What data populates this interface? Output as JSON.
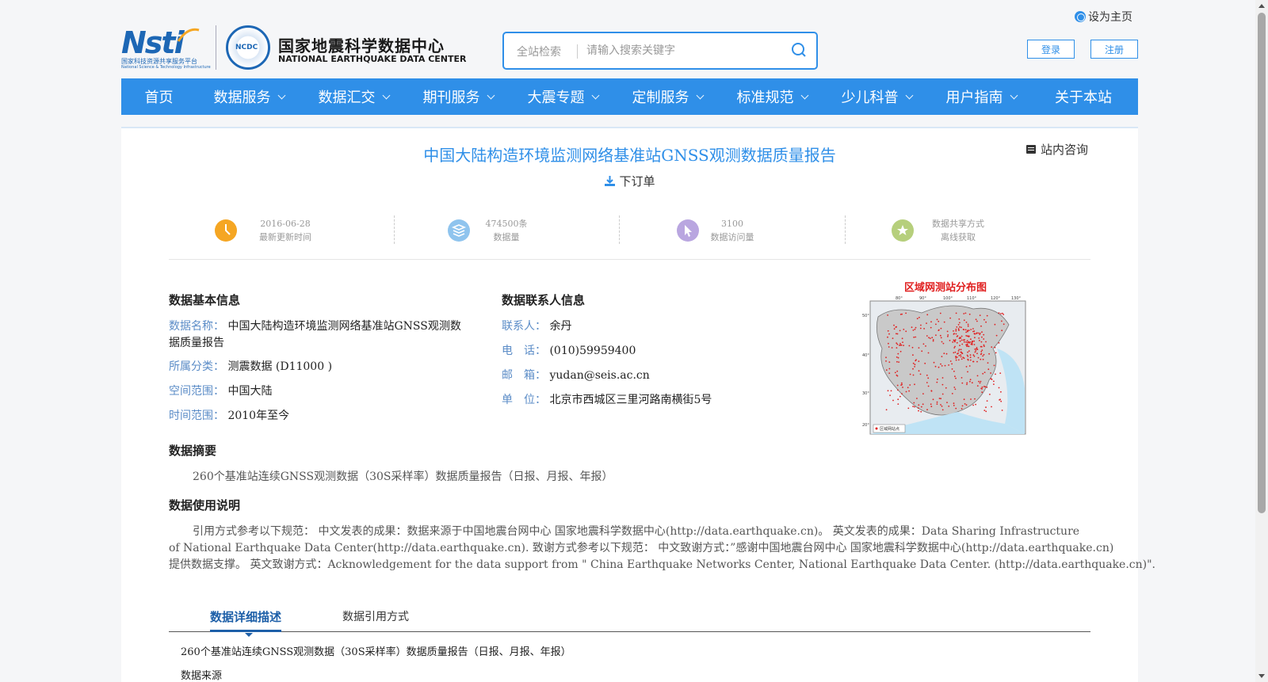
{
  "header": {
    "set_home": "设为主页",
    "logo": {
      "nsti": "Nsti",
      "nsti_sub": "国家科技资源共享服务平台",
      "nsti_sub_en": "National Science & Technology Infrastructure",
      "seal": "NCDC",
      "cn": "国家地震科学数据中心",
      "en": "NATIONAL EARTHQUAKE DATA CENTER"
    },
    "search": {
      "scope": "全站检索",
      "placeholder": "请输入搜索关键字"
    },
    "login": "登录",
    "register": "注册"
  },
  "nav": {
    "items": [
      {
        "label": "首页",
        "dropdown": false
      },
      {
        "label": "数据服务",
        "dropdown": true
      },
      {
        "label": "数据汇交",
        "dropdown": true
      },
      {
        "label": "期刊服务",
        "dropdown": true
      },
      {
        "label": "大震专题",
        "dropdown": true
      },
      {
        "label": "定制服务",
        "dropdown": true
      },
      {
        "label": "标准规范",
        "dropdown": true
      },
      {
        "label": "少儿科普",
        "dropdown": true
      },
      {
        "label": "用户指南",
        "dropdown": true
      },
      {
        "label": "关于本站",
        "dropdown": false
      }
    ]
  },
  "page": {
    "title": "中国大陆构造环境监测网络基准站GNSS观测数据质量报告",
    "consult": "站内咨询",
    "order": "下订单"
  },
  "stats": [
    {
      "value": "2016-06-28",
      "label": "最新更新时间",
      "color": "#f5a623",
      "icon": "clock-icon"
    },
    {
      "value": "474500条",
      "label": "数据量",
      "color": "#8fc4ee",
      "icon": "layers-icon"
    },
    {
      "value": "3100",
      "label": "数据访问量",
      "color": "#b9a6e0",
      "icon": "cursor-icon"
    },
    {
      "value": "数据共享方式",
      "label": "离线获取",
      "color": "#b6cf7c",
      "icon": "star-icon"
    }
  ],
  "basic_info": {
    "heading": "数据基本信息",
    "name_label": "数据名称：",
    "name": "中国大陆构造环境监测网络基准站GNSS观测数",
    "name_line2": "据质量报告",
    "category_label": "所属分类：",
    "category": "测震数据 (D11000 )",
    "space_label": "空间范围：",
    "space": "中国大陆",
    "time_label": "时间范围：",
    "time": "2010年至今"
  },
  "contact_info": {
    "heading": "数据联系人信息",
    "person_label": "联系人：",
    "person": "余丹",
    "phone_label": "电　话：",
    "phone": "(010)59959400",
    "email_label": "邮　箱：",
    "email": "yudan@seis.ac.cn",
    "unit_label": "单　位：",
    "unit": "北京市西城区三里河路南横街5号"
  },
  "map": {
    "title": "区域网测站分布图",
    "legend": "区域网站点",
    "lon_ticks": [
      "80°",
      "90°",
      "100°",
      "110°",
      "120°",
      "130°"
    ],
    "lat_ticks": [
      "50°",
      "40°",
      "30°",
      "20°"
    ]
  },
  "summary": {
    "heading": "数据摘要",
    "text": "260个基准站连续GNSS观测数据（30S采样率）数据质量报告（日报、月报、年报）"
  },
  "usage": {
    "heading": "数据使用说明",
    "line1": "引用方式参考以下规范： 中文发表的成果：数据来源于中国地震台网中心 国家地震科学数据中心(http://data.earthquake.cn)。 英文发表的成果：Data Sharing Infrastructure",
    "line2": "of National Earthquake Data Center(http://data.earthquake.cn). 致谢方式参考以下规范： 中文致谢方式：”感谢中国地震台网中心 国家地震科学数据中心(http://data.earthquake.cn)",
    "line3": "提供数据支撑。 英文致谢方式：Acknowledgement for the data support from \" China Earthquake Networks Center, National Earthquake Data Center. (http://data.earthquake.cn)\"."
  },
  "tabs": {
    "active": "数据详细描述",
    "other": "数据引用方式"
  },
  "detail": {
    "text": "260个基准站连续GNSS观测数据（30S采样率）数据质量报告（日报、月报、年报）",
    "next": "数据来源"
  }
}
